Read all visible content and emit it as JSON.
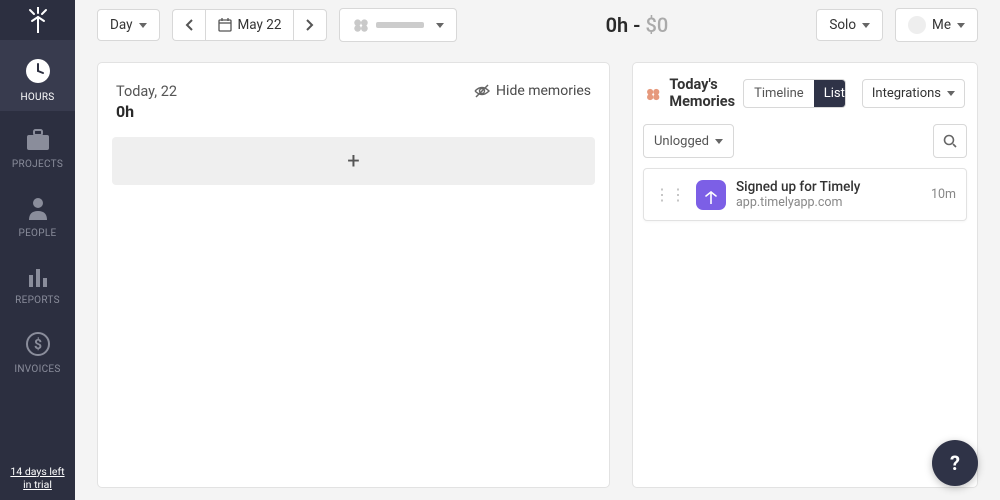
{
  "sidebar": {
    "trial": "14 days left in trial",
    "items": [
      {
        "label": "HOURS"
      },
      {
        "label": "PROJECTS"
      },
      {
        "label": "PEOPLE"
      },
      {
        "label": "REPORTS"
      },
      {
        "label": "INVOICES"
      }
    ]
  },
  "topbar": {
    "view_label": "Day",
    "date_label": "May 22",
    "summary_hours": "0h",
    "summary_dash": " - ",
    "summary_dollar": "$0",
    "mode_label": "Solo",
    "user_label": "Me"
  },
  "day": {
    "date": "Today, 22",
    "hours": "0h",
    "hide_memories": "Hide memories",
    "add_label": "+"
  },
  "memories": {
    "title_line1": "Today's",
    "title_line2": "Memories",
    "tab_timeline": "Timeline",
    "tab_list": "List",
    "integrations_label": "Integrations",
    "filter_label": "Unlogged",
    "items": [
      {
        "title": "Signed up for Timely",
        "subtitle": "app.timelyapp.com",
        "duration": "10m"
      }
    ]
  },
  "help": {
    "label": "?"
  }
}
